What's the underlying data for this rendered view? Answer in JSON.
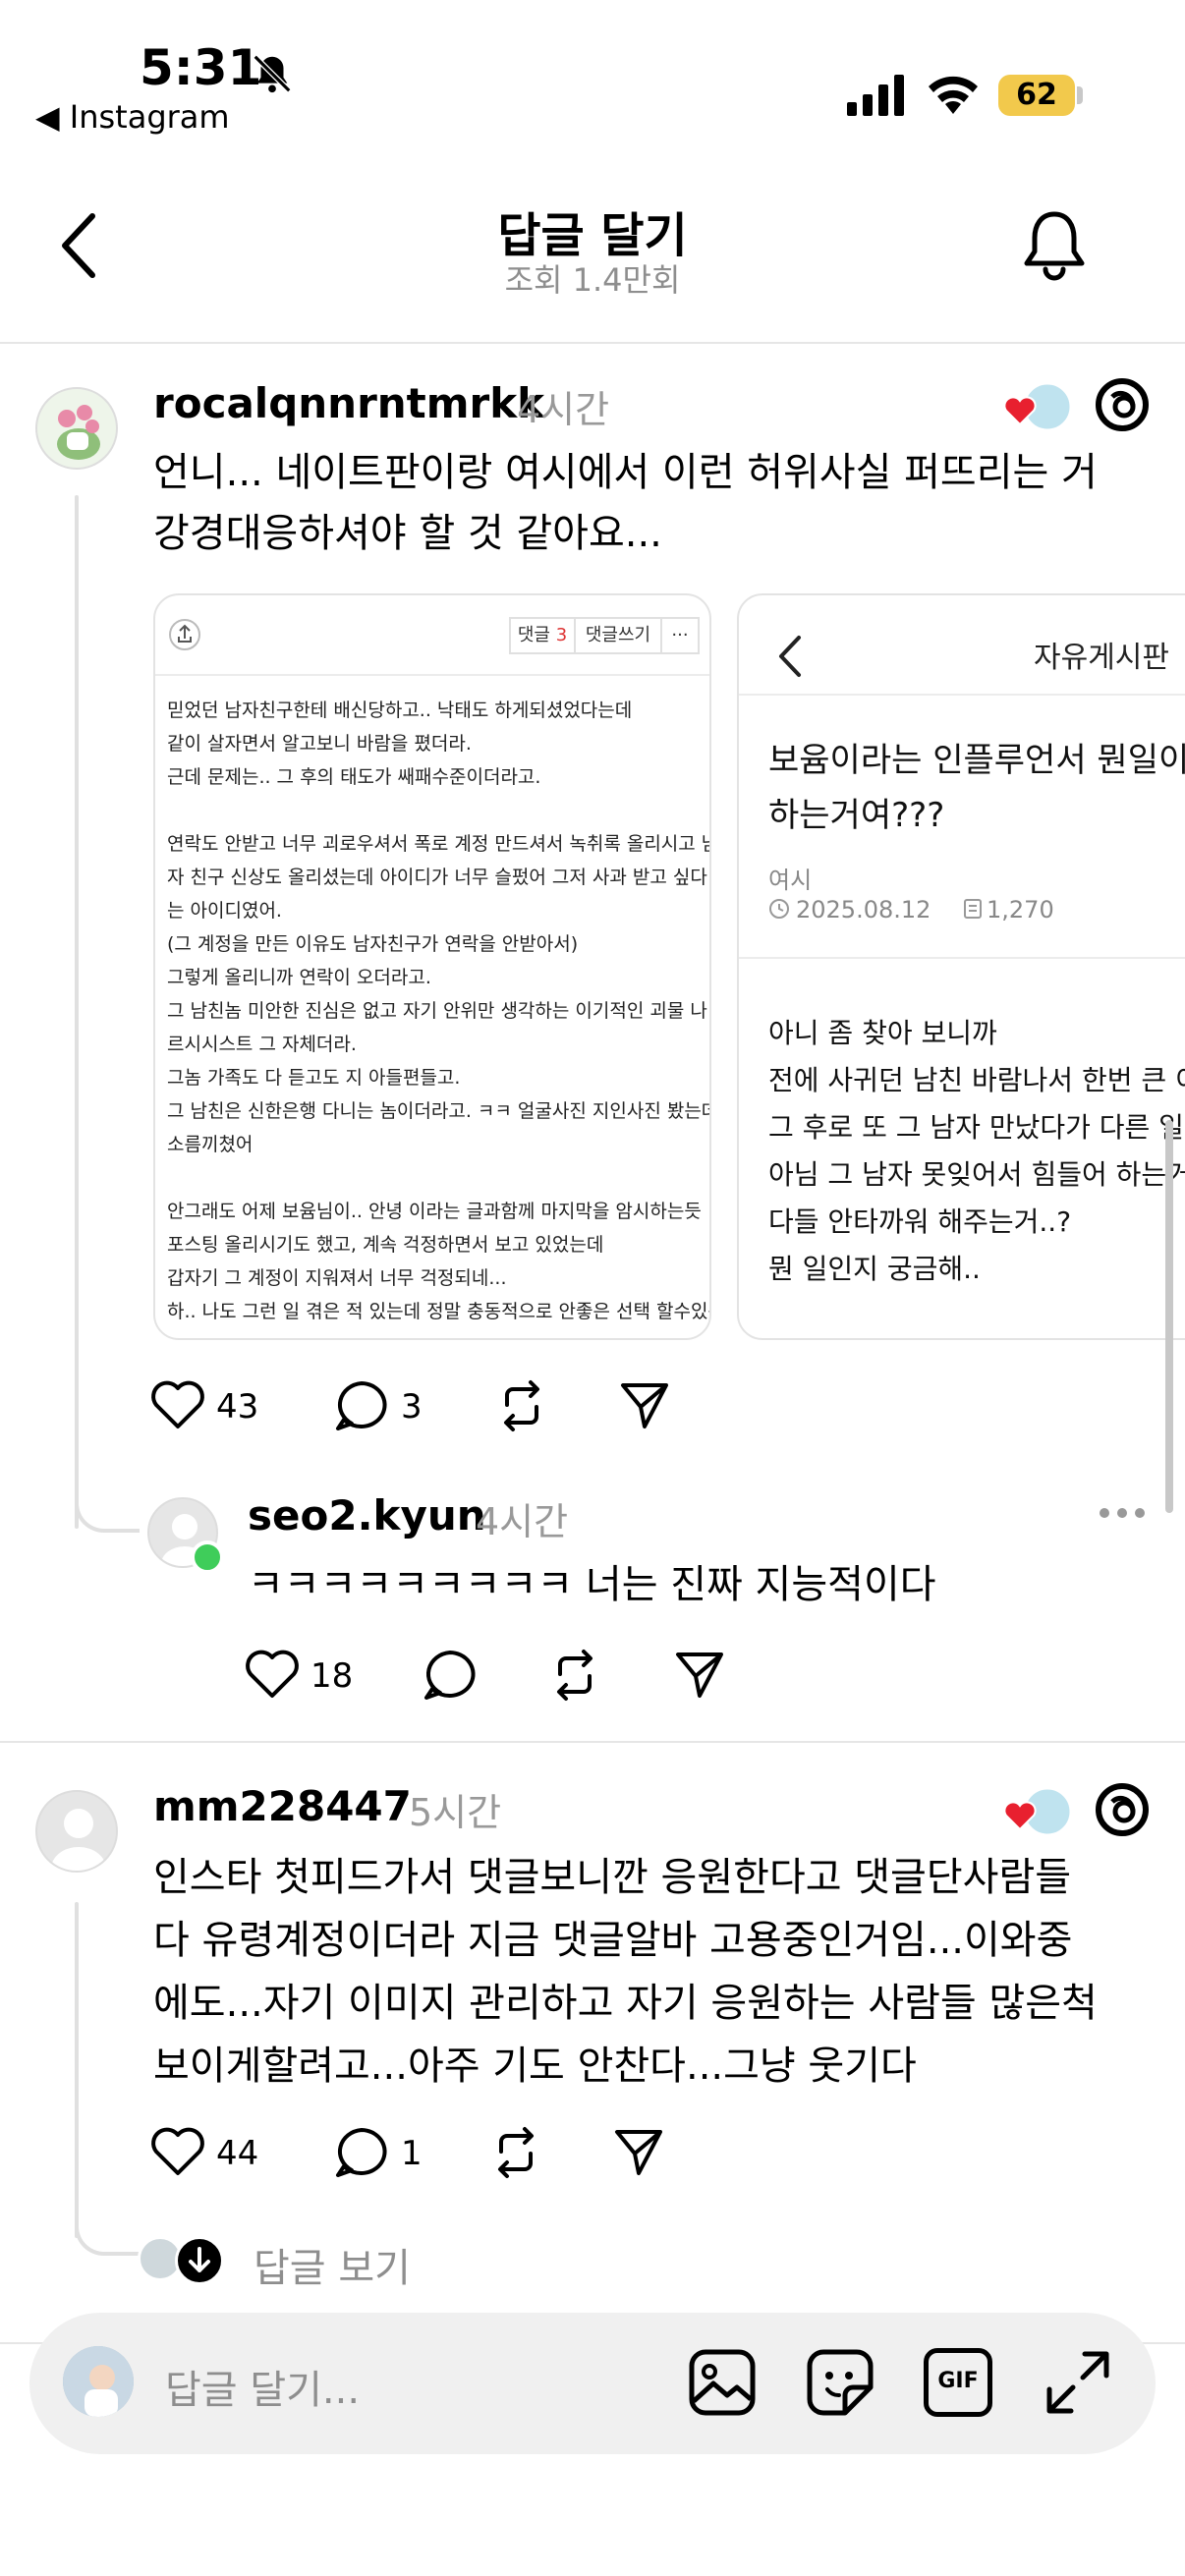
{
  "status_bar": {
    "time": "5:31",
    "back_app": "◀ Instagram",
    "battery": "62"
  },
  "header": {
    "title": "답글 달기",
    "views": "조회 1.4만회"
  },
  "post1": {
    "username": "rocalqnnrntmrkk",
    "time": "4시간",
    "text_lines": [
      "언니... 네이트판이랑 여시에서 이런 허위사실 퍼뜨리는 거",
      "강경대응하셔야 할 것 같아요..."
    ],
    "card1": {
      "comment_label": "댓글",
      "comment_count": "3",
      "write_label": "댓글쓰기",
      "more": "···",
      "lines": [
        "믿었던 남자친구한테 배신당하고.. 낙태도 하게되셨었다는데",
        "같이 살자면서 알고보니 바람을 폈더라.",
        "근데 문제는.. 그 후의 태도가 쌔패수준이더라고.",
        "",
        "연락도 안받고 너무 괴로우셔서 폭로 계정 만드셔서 녹취록 올리시고 남",
        "자 친구 신상도 올리셨는데 아이디가 너무 슬펐어 그저 사과 받고 싶다",
        "는 아이디였어.",
        "(그 계정을 만든 이유도 남자친구가 연락을 안받아서)",
        "그렇게 올리니까 연락이 오더라고.",
        "그 남친놈 미안한 진심은 없고 자기 안위만 생각하는 이기적인 괴물 나",
        "르시시스트 그 자체더라.",
        "그놈 가족도 다 듣고도 지 아들편들고.",
        "그 남친은 신한은행 다니는 놈이더라고. ㅋㅋ 얼굴사진 지인사진 봤는데",
        "소름끼쳤어",
        "",
        "안그래도 어제 보윰님이.. 안녕 이라는 글과함께 마지막을 암시하는듯",
        "포스팅 올리시기도 했고, 계속 걱정하면서 보고 있었는데",
        "갑자기 그 계정이 지워져서 너무 걱정되네...",
        "하.. 나도 그런 일 겪은 적 있는데 정말 충동적으로 안좋은 선택 할수있는"
      ]
    },
    "card2": {
      "board": "자유게시판",
      "title_lines": [
        "보윰이라는 인플루언서 뭔일이",
        "하는거여???"
      ],
      "source": "여시",
      "date": "2025.08.12",
      "views": "1,270",
      "body_lines": [
        "아니 좀 찾아 보니까",
        "전에 사귀던 남친 바람나서 한번 큰 이",
        "그 후로 또 그 남자 만났다가 다른 일",
        "아님 그 남자 못잊어서 힘들어 하는거",
        "다들 안타까워 해주는거..?",
        "뭔 일인지 궁금해.."
      ]
    },
    "likes": "43",
    "comments": "3"
  },
  "reply1": {
    "username": "seo2.kyun",
    "time": "4시간",
    "text": "ㅋㅋㅋㅋㅋㅋㅋㅋㅋ 너는 진짜 지능적이다",
    "likes": "18"
  },
  "post2": {
    "username": "mm228447",
    "time": "5시간",
    "text_lines": [
      "인스타 첫피드가서 댓글보니깐 응원한다고 댓글단사람들",
      "다 유령계정이더라 지금 댓글알바 고용중인거임...이와중",
      "에도...자기 이미지 관리하고 자기 응원하는 사람들 많은척",
      "보이게할려고...아주 기도 안찬다...그냥 웃기다"
    ],
    "likes": "44",
    "comments": "1",
    "view_replies": "답글 보기"
  },
  "composer": {
    "placeholder": "답글 달기...",
    "gif": "GIF"
  }
}
